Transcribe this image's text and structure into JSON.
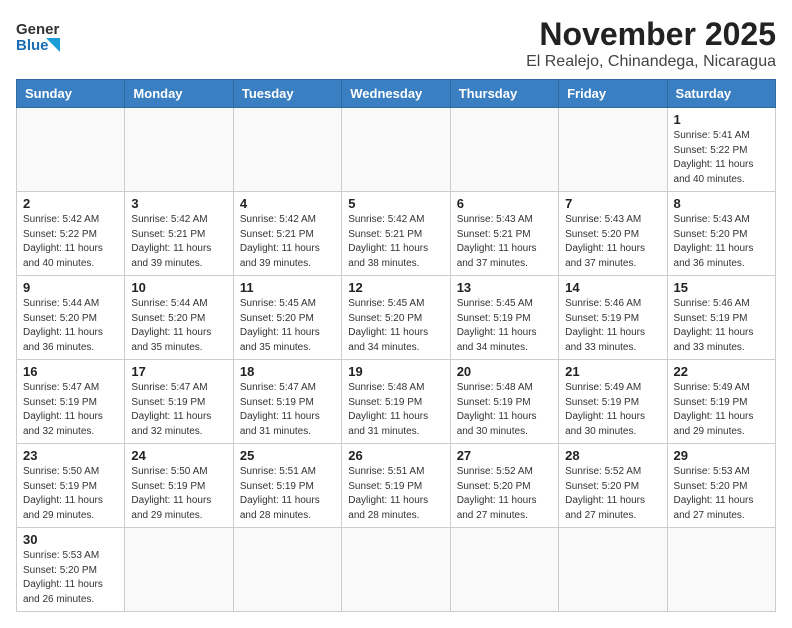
{
  "header": {
    "logo_general": "General",
    "logo_blue": "Blue",
    "title": "November 2025",
    "subtitle": "El Realejo, Chinandega, Nicaragua"
  },
  "weekdays": [
    "Sunday",
    "Monday",
    "Tuesday",
    "Wednesday",
    "Thursday",
    "Friday",
    "Saturday"
  ],
  "weeks": [
    [
      {
        "day": "",
        "info": ""
      },
      {
        "day": "",
        "info": ""
      },
      {
        "day": "",
        "info": ""
      },
      {
        "day": "",
        "info": ""
      },
      {
        "day": "",
        "info": ""
      },
      {
        "day": "",
        "info": ""
      },
      {
        "day": "1",
        "info": "Sunrise: 5:41 AM\nSunset: 5:22 PM\nDaylight: 11 hours\nand 40 minutes."
      }
    ],
    [
      {
        "day": "2",
        "info": "Sunrise: 5:42 AM\nSunset: 5:22 PM\nDaylight: 11 hours\nand 40 minutes."
      },
      {
        "day": "3",
        "info": "Sunrise: 5:42 AM\nSunset: 5:21 PM\nDaylight: 11 hours\nand 39 minutes."
      },
      {
        "day": "4",
        "info": "Sunrise: 5:42 AM\nSunset: 5:21 PM\nDaylight: 11 hours\nand 39 minutes."
      },
      {
        "day": "5",
        "info": "Sunrise: 5:42 AM\nSunset: 5:21 PM\nDaylight: 11 hours\nand 38 minutes."
      },
      {
        "day": "6",
        "info": "Sunrise: 5:43 AM\nSunset: 5:21 PM\nDaylight: 11 hours\nand 37 minutes."
      },
      {
        "day": "7",
        "info": "Sunrise: 5:43 AM\nSunset: 5:20 PM\nDaylight: 11 hours\nand 37 minutes."
      },
      {
        "day": "8",
        "info": "Sunrise: 5:43 AM\nSunset: 5:20 PM\nDaylight: 11 hours\nand 36 minutes."
      }
    ],
    [
      {
        "day": "9",
        "info": "Sunrise: 5:44 AM\nSunset: 5:20 PM\nDaylight: 11 hours\nand 36 minutes."
      },
      {
        "day": "10",
        "info": "Sunrise: 5:44 AM\nSunset: 5:20 PM\nDaylight: 11 hours\nand 35 minutes."
      },
      {
        "day": "11",
        "info": "Sunrise: 5:45 AM\nSunset: 5:20 PM\nDaylight: 11 hours\nand 35 minutes."
      },
      {
        "day": "12",
        "info": "Sunrise: 5:45 AM\nSunset: 5:20 PM\nDaylight: 11 hours\nand 34 minutes."
      },
      {
        "day": "13",
        "info": "Sunrise: 5:45 AM\nSunset: 5:19 PM\nDaylight: 11 hours\nand 34 minutes."
      },
      {
        "day": "14",
        "info": "Sunrise: 5:46 AM\nSunset: 5:19 PM\nDaylight: 11 hours\nand 33 minutes."
      },
      {
        "day": "15",
        "info": "Sunrise: 5:46 AM\nSunset: 5:19 PM\nDaylight: 11 hours\nand 33 minutes."
      }
    ],
    [
      {
        "day": "16",
        "info": "Sunrise: 5:47 AM\nSunset: 5:19 PM\nDaylight: 11 hours\nand 32 minutes."
      },
      {
        "day": "17",
        "info": "Sunrise: 5:47 AM\nSunset: 5:19 PM\nDaylight: 11 hours\nand 32 minutes."
      },
      {
        "day": "18",
        "info": "Sunrise: 5:47 AM\nSunset: 5:19 PM\nDaylight: 11 hours\nand 31 minutes."
      },
      {
        "day": "19",
        "info": "Sunrise: 5:48 AM\nSunset: 5:19 PM\nDaylight: 11 hours\nand 31 minutes."
      },
      {
        "day": "20",
        "info": "Sunrise: 5:48 AM\nSunset: 5:19 PM\nDaylight: 11 hours\nand 30 minutes."
      },
      {
        "day": "21",
        "info": "Sunrise: 5:49 AM\nSunset: 5:19 PM\nDaylight: 11 hours\nand 30 minutes."
      },
      {
        "day": "22",
        "info": "Sunrise: 5:49 AM\nSunset: 5:19 PM\nDaylight: 11 hours\nand 29 minutes."
      }
    ],
    [
      {
        "day": "23",
        "info": "Sunrise: 5:50 AM\nSunset: 5:19 PM\nDaylight: 11 hours\nand 29 minutes."
      },
      {
        "day": "24",
        "info": "Sunrise: 5:50 AM\nSunset: 5:19 PM\nDaylight: 11 hours\nand 29 minutes."
      },
      {
        "day": "25",
        "info": "Sunrise: 5:51 AM\nSunset: 5:19 PM\nDaylight: 11 hours\nand 28 minutes."
      },
      {
        "day": "26",
        "info": "Sunrise: 5:51 AM\nSunset: 5:19 PM\nDaylight: 11 hours\nand 28 minutes."
      },
      {
        "day": "27",
        "info": "Sunrise: 5:52 AM\nSunset: 5:20 PM\nDaylight: 11 hours\nand 27 minutes."
      },
      {
        "day": "28",
        "info": "Sunrise: 5:52 AM\nSunset: 5:20 PM\nDaylight: 11 hours\nand 27 minutes."
      },
      {
        "day": "29",
        "info": "Sunrise: 5:53 AM\nSunset: 5:20 PM\nDaylight: 11 hours\nand 27 minutes."
      }
    ],
    [
      {
        "day": "30",
        "info": "Sunrise: 5:53 AM\nSunset: 5:20 PM\nDaylight: 11 hours\nand 26 minutes."
      },
      {
        "day": "",
        "info": ""
      },
      {
        "day": "",
        "info": ""
      },
      {
        "day": "",
        "info": ""
      },
      {
        "day": "",
        "info": ""
      },
      {
        "day": "",
        "info": ""
      },
      {
        "day": "",
        "info": ""
      }
    ]
  ]
}
